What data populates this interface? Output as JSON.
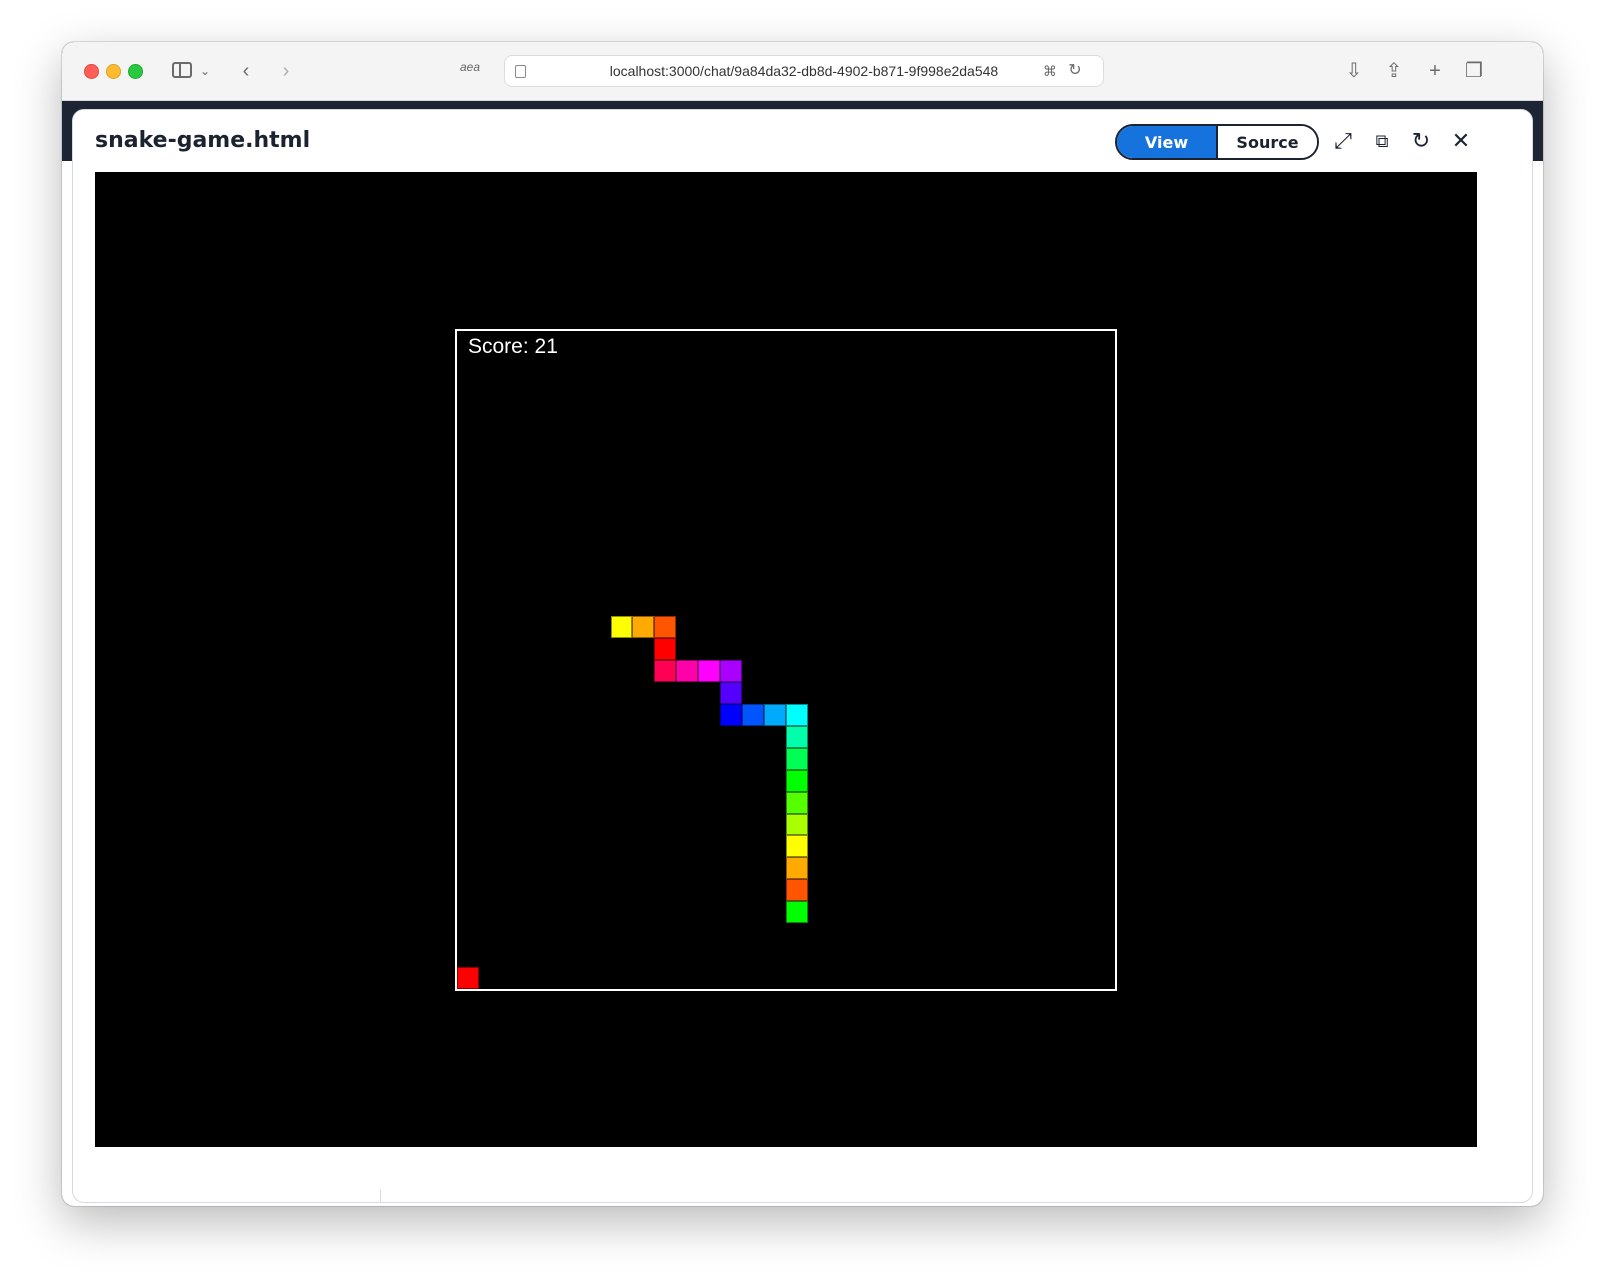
{
  "browser": {
    "url": "localhost:3000/chat/9a84da32-db8d-4902-b871-9f998e2da548",
    "reader_label": "aea"
  },
  "modal": {
    "title": "snake-game.html",
    "view_label": "View",
    "source_label": "Source",
    "accent": "#1673dd"
  },
  "game": {
    "score_text": "Score: 21",
    "grid_cells": 30,
    "snake": [
      {
        "col": 7,
        "row": 13,
        "color": "#ffff00"
      },
      {
        "col": 8,
        "row": 13,
        "color": "#ffaa00"
      },
      {
        "col": 9,
        "row": 13,
        "color": "#ff5500"
      },
      {
        "col": 9,
        "row": 14,
        "color": "#ff0000"
      },
      {
        "col": 9,
        "row": 15,
        "color": "#ff0055"
      },
      {
        "col": 10,
        "row": 15,
        "color": "#ff00aa"
      },
      {
        "col": 11,
        "row": 15,
        "color": "#ff00ff"
      },
      {
        "col": 12,
        "row": 15,
        "color": "#aa00ff"
      },
      {
        "col": 12,
        "row": 16,
        "color": "#5500ff"
      },
      {
        "col": 12,
        "row": 17,
        "color": "#0000ff"
      },
      {
        "col": 13,
        "row": 17,
        "color": "#0055ff"
      },
      {
        "col": 14,
        "row": 17,
        "color": "#00aaff"
      },
      {
        "col": 15,
        "row": 17,
        "color": "#00ffff"
      },
      {
        "col": 15,
        "row": 18,
        "color": "#00ffaa"
      },
      {
        "col": 15,
        "row": 19,
        "color": "#00ff55"
      },
      {
        "col": 15,
        "row": 20,
        "color": "#00ff00"
      },
      {
        "col": 15,
        "row": 21,
        "color": "#55ff00"
      },
      {
        "col": 15,
        "row": 22,
        "color": "#aaff00"
      },
      {
        "col": 15,
        "row": 23,
        "color": "#ffff00"
      },
      {
        "col": 15,
        "row": 24,
        "color": "#ffaa00"
      },
      {
        "col": 15,
        "row": 25,
        "color": "#ff5500"
      },
      {
        "col": 15,
        "row": 26,
        "color": "#00ff00"
      }
    ],
    "food": {
      "col": 0,
      "row": 29,
      "color": "#ff0000"
    }
  }
}
